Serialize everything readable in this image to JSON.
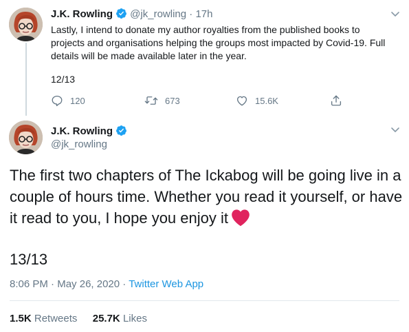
{
  "tweet1": {
    "author": "J.K. Rowling",
    "handle": "@jk_rowling",
    "separator": "·",
    "time": "17h",
    "text": "Lastly, I intend to donate my author royalties from the published books to projects and organisations helping the groups most impacted by Covid-19. Full details will be made available later in the year.",
    "thread_count": "12/13",
    "replies": "120",
    "retweets": "673",
    "likes": "15.6K"
  },
  "tweet2": {
    "author": "J.K. Rowling",
    "handle": "@jk_rowling",
    "text": "The first two chapters of The Ickabog will be going live in a couple of hours time. Whether you read it yourself, or have it read to you, I hope you enjoy it",
    "thread_count": "13/13",
    "time": "8:06 PM",
    "separator1": "·",
    "date": "May 26, 2020",
    "separator2": "·",
    "source": "Twitter Web App",
    "retweets_value": "1.5K",
    "retweets_label": "Retweets",
    "likes_value": "25.7K",
    "likes_label": "Likes"
  },
  "icons": {
    "verified": "verified-badge-icon",
    "chevron": "chevron-down-icon",
    "reply": "reply-icon",
    "retweet": "retweet-icon",
    "like": "like-icon",
    "share": "share-icon",
    "heart_emoji": "red-heart-icon"
  },
  "colors": {
    "accent": "#1da1f2",
    "link": "#1b95e0",
    "muted": "#657786",
    "heart": "#e0245e"
  }
}
